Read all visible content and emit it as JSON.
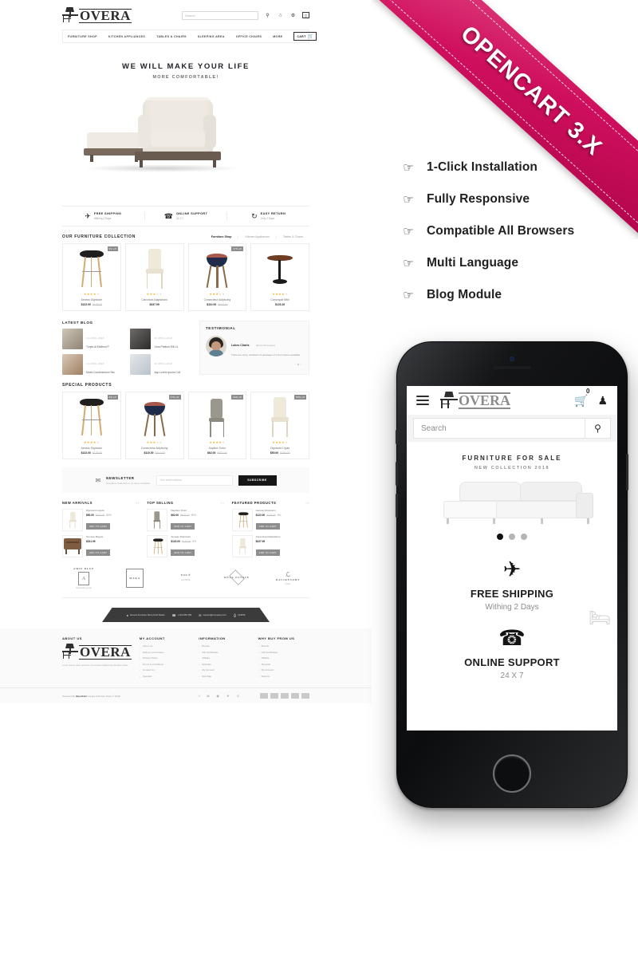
{
  "ribbon": {
    "text": "OPENCART 3.X",
    "color": "#cf0f5d"
  },
  "features": [
    {
      "icon": "hand-pointing-icon",
      "label": "1-Click Installation"
    },
    {
      "icon": "hand-pointing-icon",
      "label": "Fully Responsive"
    },
    {
      "icon": "hand-pointing-icon",
      "label": "Compatible All Browsers"
    },
    {
      "icon": "hand-pointing-icon",
      "label": "Multi Language"
    },
    {
      "icon": "hand-pointing-icon",
      "label": "Blog Module"
    }
  ],
  "desktop": {
    "logo": "OVERA",
    "search_placeholder": "Search",
    "header_icons": [
      "search-icon",
      "user-icon",
      "gear-icon",
      "compare-icon"
    ],
    "nav": [
      "FURNITURE SHOP",
      "KITCHEN APPLIANCES",
      "TABLES & CHAIRS",
      "SLEEPING AREA",
      "OFFICE CHAIRS",
      "MORE"
    ],
    "cart_label": "CART",
    "hero": {
      "title": "WE WILL MAKE YOUR LIFE",
      "subtitle": "MORE COMFORTABLE!"
    },
    "services": [
      {
        "icon": "paper-plane-icon",
        "title": "FREE SHIPPING",
        "sub": "Withing 2 Days"
      },
      {
        "icon": "phone-icon",
        "title": "ONLINE SUPPORT",
        "sub": "24 X 7"
      },
      {
        "icon": "refresh-icon",
        "title": "EASY RETURN",
        "sub": "Only 2 Days"
      }
    ],
    "collection": {
      "title": "OUR FURNITURE COLLECTION",
      "tabs": [
        "Furniture Shop",
        "Kitchen Appliances",
        "Tables & Chairs"
      ],
      "active_tab": "Furniture Shop",
      "products": [
        {
          "name": "Aenean Dignissim",
          "price": "$122.00",
          "old_price": "$128.00",
          "badge": "5% off",
          "stars": 4
        },
        {
          "name": "Canonical Adaptations",
          "price": "$337.99",
          "old_price": "",
          "badge": "",
          "stars": 3
        },
        {
          "name": "Consectetur Adipiscing",
          "price": "$110.00",
          "old_price": "$442.00",
          "badge": "37% off",
          "stars": 3
        },
        {
          "name": "Consequat Nibh",
          "price": "$123.20",
          "old_price": "",
          "badge": "",
          "stars": 4
        }
      ]
    },
    "blog": {
      "title": "LATEST BLOG",
      "posts": [
        {
          "date": "10 APRIL 2018",
          "title": "Turpis At Eleifend P"
        },
        {
          "date": "10 APRIL 2018",
          "title": "Urna Pretium Elit Lit"
        },
        {
          "date": "10 APRIL 2018",
          "title": "Morbi Condimentum Nto"
        },
        {
          "date": "10 APRIL 2018",
          "title": "App Lorem Ipsum Coll"
        }
      ]
    },
    "testimonial": {
      "title": "TESTIMONIAL",
      "name": "Lukes Charls",
      "role": "(Iphone Developer)",
      "quote": "There are many variations of passages of Lorem Ipsum available"
    },
    "special": {
      "title": "SPECIAL PRODUCTS",
      "products": [
        {
          "name": "Aenean Dignissim",
          "price": "$122.00",
          "old_price": "$128.00",
          "badge": "5% off",
          "stars": 4
        },
        {
          "name": "Consectetur Adipiscing",
          "price": "$110.00",
          "old_price": "$442.00",
          "badge": "37% off",
          "stars": 3
        },
        {
          "name": "Dapibus Tortor",
          "price": "$62.00",
          "old_price": "$602.00",
          "badge": "90% off",
          "stars": 4
        },
        {
          "name": "Dignissim Ligula",
          "price": "$50.00",
          "old_price": "$200.00",
          "badge": "80% off",
          "stars": 4
        }
      ]
    },
    "newsletter": {
      "icon": "envelope-icon",
      "title": "NEWSLETTER",
      "sub": "Newsletter Subscribe to our latest newsletter",
      "placeholder": "Your email address",
      "button": "SUBSCRIBE"
    },
    "lists": [
      {
        "title": "NEW ARRIVALS",
        "items": [
          {
            "name": "Dignissim Ligula",
            "price": "$50.00",
            "old_price": "$200.00",
            "discount": "80%",
            "cart": "ADD TO CART"
          },
          {
            "name": "Tempus Magna",
            "price": "$241.99",
            "old_price": "",
            "discount": "",
            "cart": "ADD TO CART"
          }
        ]
      },
      {
        "title": "TOP SELLING",
        "items": [
          {
            "name": "Dapibus Tortor",
            "price": "$62.00",
            "old_price": "$602.00",
            "discount": "90%",
            "cart": "ADD TO CART"
          },
          {
            "name": "Aenean Dignissim",
            "price": "$122.00",
            "old_price": "$128.00",
            "discount": "5%",
            "cart": "ADD TO CART"
          }
        ]
      },
      {
        "title": "FEATURED PRODUCTS",
        "items": [
          {
            "name": "Aenean Dignissim",
            "price": "$122.00",
            "old_price": "$128.00",
            "discount": "5%",
            "cart": "ADD TO CART"
          },
          {
            "name": "Canonical Adaptations",
            "price": "$337.99",
            "old_price": "",
            "discount": "",
            "cart": "ADD TO CART"
          }
        ]
      }
    ],
    "brands": [
      {
        "name": "AMIE BLUE",
        "sub": "handcrafted goods",
        "mark": "A"
      },
      {
        "name": "MARA",
        "sub": "",
        "mark": ""
      },
      {
        "name": "NOLÉ",
        "sub": "and NOLÉ",
        "mark": ""
      },
      {
        "name": "REAL ESTATE",
        "sub": "",
        "mark": ""
      },
      {
        "name": "BALIRESORT",
        "sub": "hotels",
        "mark": ""
      }
    ],
    "contact": [
      {
        "icon": "location-icon",
        "text": "Hovera Furniture Store,Hind States"
      },
      {
        "icon": "phone-icon",
        "text": "+123-456-789"
      },
      {
        "icon": "mail-icon",
        "text": "support@company.com"
      },
      {
        "icon": "fax-icon",
        "text": "123456"
      }
    ],
    "footer": {
      "about": {
        "title": "ABOUT US",
        "logo": "OVERA",
        "text": "Lorem ipsum dolor sit amet, consectetur adipiscing elit,ipsum dolor"
      },
      "columns": [
        {
          "title": "MY ACCOUNT",
          "links": [
            "About Us",
            "Delivery Information",
            "Privacy Policy",
            "Terms & Conditions",
            "Contact Us",
            "Specials"
          ]
        },
        {
          "title": "INFORMATION",
          "links": [
            "Brands",
            "Gift Certificates",
            "Affiliate",
            "Specials",
            "My Account",
            "Site Map"
          ]
        },
        {
          "title": "WHY BUY FROM US",
          "links": [
            "Brands",
            "Gift Certificates",
            "Affiliate",
            "Specials",
            "My Account",
            "Returns"
          ]
        }
      ],
      "copyright_pre": "Powered By ",
      "copyright_brand": "OpenCart",
      "copyright_post": " Hovera Furniture Store © 2018",
      "social": [
        "facebook-icon",
        "twitter-icon",
        "rss-icon",
        "pinterest-icon",
        "google-plus-icon"
      ]
    }
  },
  "phone": {
    "logo": "OVERA",
    "cart_count": "0",
    "search_placeholder": "Search",
    "hero": {
      "title": "FURNITURE FOR SALE",
      "subtitle": "NEW COLLECTION 2018"
    },
    "services": [
      {
        "icon": "paper-plane-icon",
        "title": "FREE SHIPPING",
        "sub": "Withing 2 Days"
      },
      {
        "icon": "phone-icon",
        "title": "ONLINE SUPPORT",
        "sub": "24 X 7"
      }
    ],
    "side_icon": "armchair-icon"
  }
}
